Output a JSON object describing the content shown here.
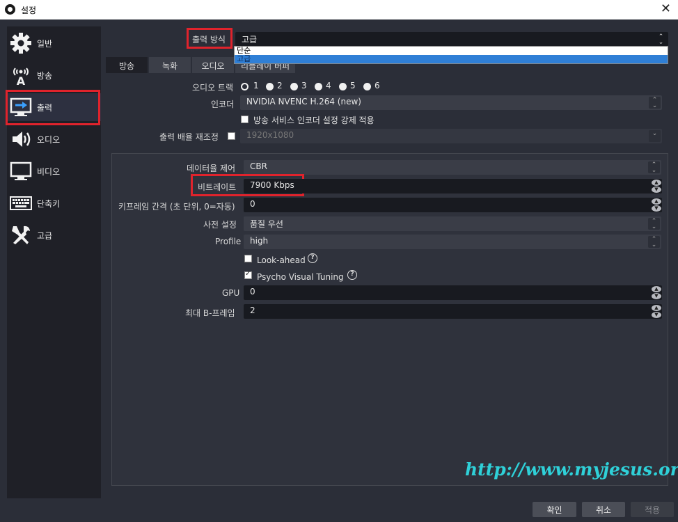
{
  "window": {
    "title": "설정"
  },
  "sidebar": {
    "items": [
      {
        "label": "일반",
        "icon": "gear-icon"
      },
      {
        "label": "방송",
        "icon": "broadcast-antenna-icon"
      },
      {
        "label": "출력",
        "icon": "output-monitor-icon"
      },
      {
        "label": "오디오",
        "icon": "speaker-icon"
      },
      {
        "label": "비디오",
        "icon": "monitor-icon"
      },
      {
        "label": "단축키",
        "icon": "keyboard-icon"
      },
      {
        "label": "고급",
        "icon": "tools-icon"
      }
    ],
    "selected": "출력"
  },
  "output_mode": {
    "label": "출력 방식",
    "value": "고급",
    "options": [
      "단순",
      "고급"
    ]
  },
  "tabs": [
    {
      "label": "방송"
    },
    {
      "label": "녹화"
    },
    {
      "label": "오디오"
    },
    {
      "label": "리플레이 버퍼"
    }
  ],
  "stream": {
    "audio_track_label": "오디오 트랙",
    "audio_tracks": [
      "1",
      "2",
      "3",
      "4",
      "5",
      "6"
    ],
    "encoder_label": "인코더",
    "encoder_value": "NVIDIA NVENC H.264 (new)",
    "enforce_label": "방송 서비스 인코더 설정 강제 적용",
    "rescale_label": "출력 배율 재조정",
    "rescale_value": "1920x1080"
  },
  "encoder_settings": {
    "rate_control_label": "데이터율 제어",
    "rate_control_value": "CBR",
    "bitrate_label": "비트레이트",
    "bitrate_value": "7900 Kbps",
    "keyframe_label": "키프레임 간격 (초 단위, 0=자동)",
    "keyframe_value": "0",
    "preset_label": "사전 설정",
    "preset_value": "품질 우선",
    "profile_label": "Profile",
    "profile_value": "high",
    "lookahead_label": "Look-ahead",
    "psycho_label": "Psycho Visual Tuning",
    "gpu_label": "GPU",
    "gpu_value": "0",
    "bframes_label": "최대 B-프레임",
    "bframes_value": "2"
  },
  "buttons": {
    "ok": "확인",
    "cancel": "취소",
    "apply": "적용"
  },
  "watermark": "http://www.myjesus.or.kr",
  "colors": {
    "highlight_red": "#e0232c",
    "watermark": "#2fd0d8",
    "selection_blue": "#2f7fd6"
  }
}
